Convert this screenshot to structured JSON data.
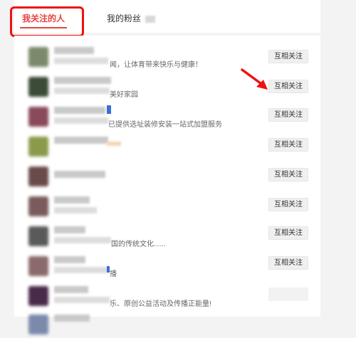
{
  "tabs": {
    "following_label": "我关注的人",
    "fans_label": "我的粉丝"
  },
  "colors": {
    "accent": "#e64340",
    "highlight": "#ee1111"
  },
  "rows": [
    {
      "signature": "闻，让体育带来快乐与健康！",
      "button": "互相关注",
      "avatar_color": "#7a8a6a"
    },
    {
      "signature": "美好家园",
      "button": "互相关注",
      "avatar_color": "#3b4b38"
    },
    {
      "signature": "已提供选址装修安装一站式加盟服务",
      "button": "互相关注",
      "avatar_color": "#8a4a5a"
    },
    {
      "signature": "",
      "button": "互相关注",
      "avatar_color": "#8a9a4a"
    },
    {
      "signature": "",
      "button": "互相关注",
      "avatar_color": "#6a4a4a"
    },
    {
      "signature": "",
      "button": "互相关注",
      "avatar_color": "#7a5a5a"
    },
    {
      "signature": "国的传统文化......",
      "button": "互相关注",
      "avatar_color": "#5a5a5a"
    },
    {
      "signature": "播",
      "button": "互相关注",
      "avatar_color": "#8a6a6a"
    },
    {
      "signature": "乐、原创公益活动及传播正能量!",
      "button": "",
      "avatar_color": "#4a2a4a"
    },
    {
      "signature": "",
      "button": "",
      "avatar_color": "#7a8aaa"
    }
  ]
}
